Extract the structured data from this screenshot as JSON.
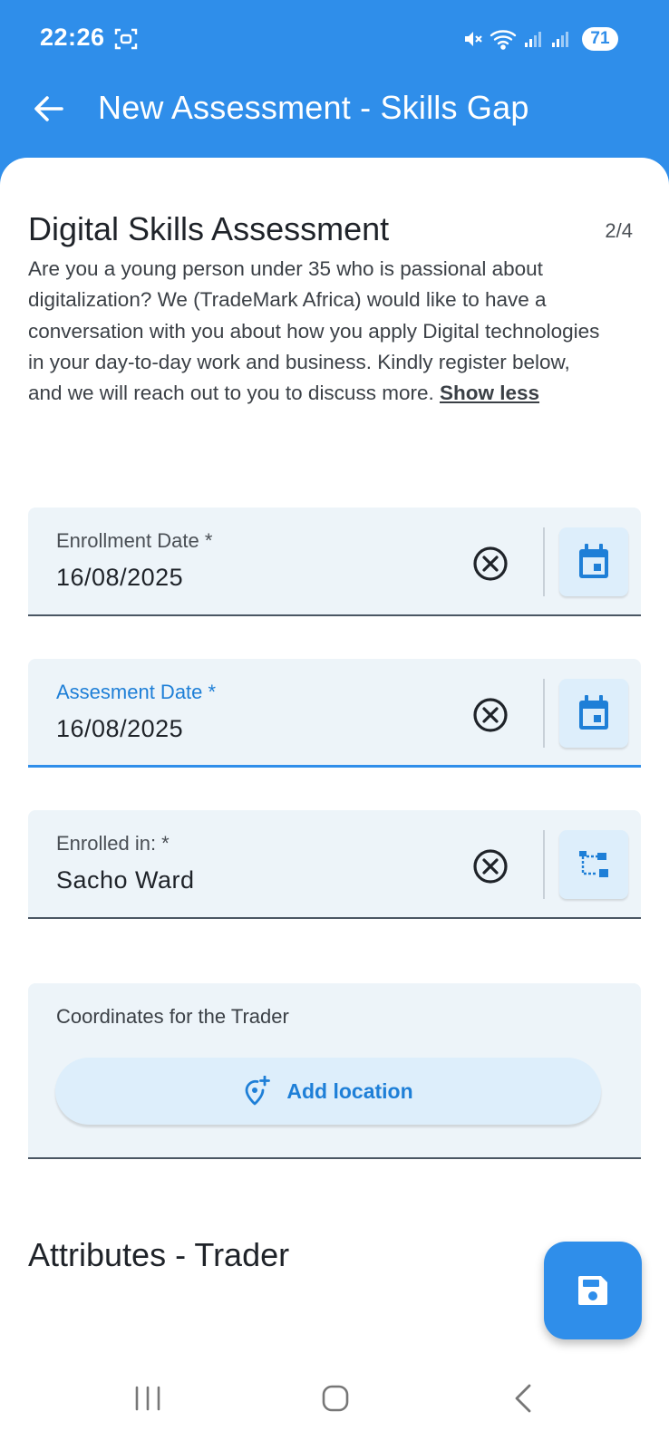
{
  "status_bar": {
    "time": "22:26",
    "battery": "71",
    "icons": [
      "screenshot-icon",
      "mute-icon",
      "wifi-icon",
      "signal-icon",
      "signal-icon"
    ]
  },
  "app_bar": {
    "title": "New Assessment - Skills Gap",
    "back_icon": "arrow-left-icon"
  },
  "section": {
    "title": "Digital Skills Assessment",
    "step": "2/4",
    "description": "Are you a young person under 35 who is passional about digitalization? We (TradeMark Africa) would like to have a conversation with you about how you apply Digital technologies in your day-to-day work and business. Kindly register below, and we will reach out to you to discuss more. ",
    "show_less": "Show less"
  },
  "fields": [
    {
      "label": "Enrollment Date *",
      "value": "16/08/2025",
      "picker_icon": "calendar-icon"
    },
    {
      "label": "Assesment Date *",
      "value": "16/08/2025",
      "picker_icon": "calendar-icon",
      "focused": true
    },
    {
      "label": "Enrolled in: *",
      "value": "Sacho Ward",
      "picker_icon": "org-tree-icon"
    }
  ],
  "coordinates": {
    "label": "Coordinates for the Trader",
    "button_label": "Add location",
    "button_icon": "add-location-icon"
  },
  "attributes": {
    "title": "Attributes - Trader"
  },
  "fab": {
    "icon": "save-icon"
  },
  "nav_bar": {
    "icons": [
      "recents-icon",
      "home-icon",
      "back-icon"
    ]
  },
  "colors": {
    "primary": "#2f8eea",
    "accent_text": "#1e7fd7",
    "field_bg": "#edf4f9",
    "button_bg": "#ddeefb"
  }
}
